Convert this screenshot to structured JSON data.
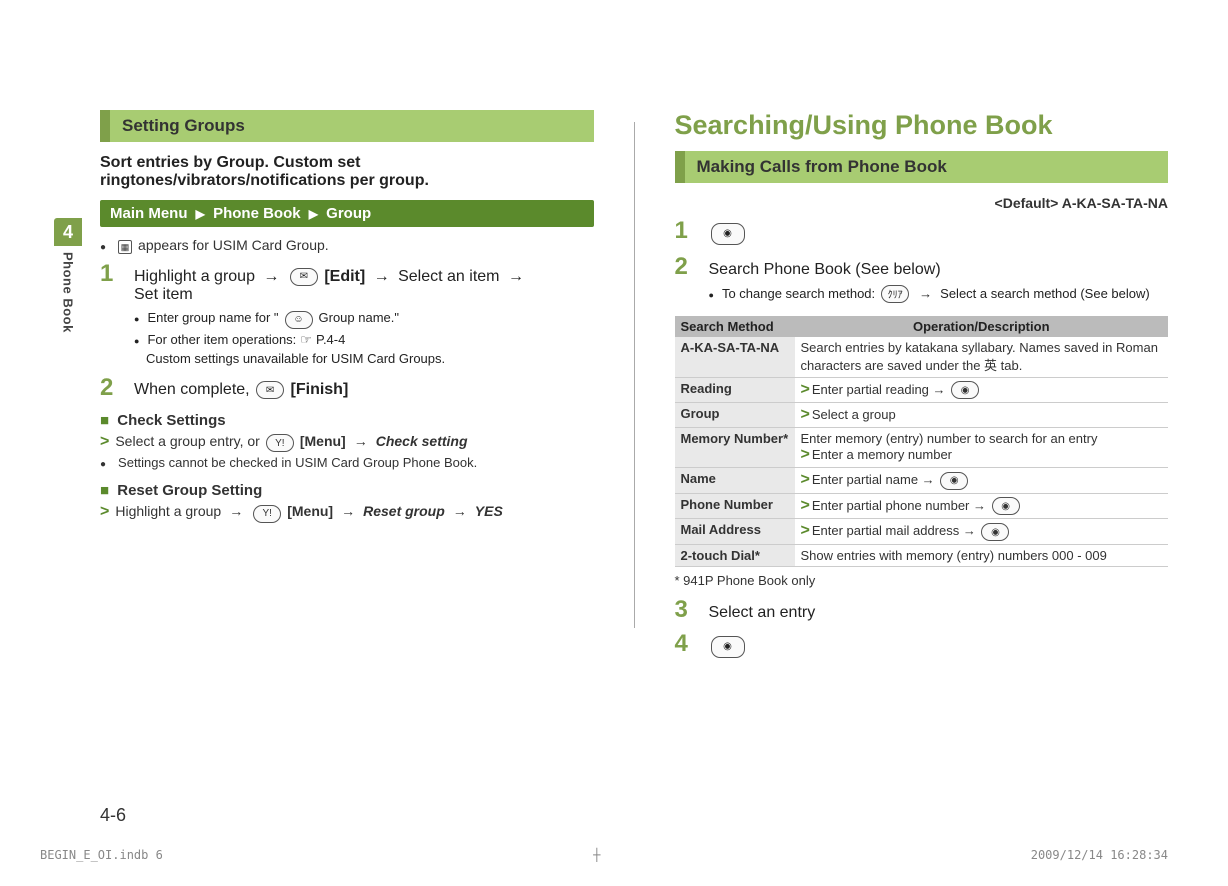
{
  "side_tab": {
    "chapter_num": "4",
    "chapter_title": "Phone Book"
  },
  "left": {
    "heading": "Setting Groups",
    "intro": "Sort entries by Group. Custom set ringtones/vibrators/notifications per group.",
    "nav": {
      "main": "Main Menu",
      "l1": "Phone Book",
      "l2": "Group"
    },
    "usim_note": " appears for USIM Card Group.",
    "step1": {
      "text_a": "Highlight a group ",
      "btn_label": "[Edit]",
      "text_b": " Select an item ",
      "text_c": "Set item",
      "sub1_a": "Enter group name for \"",
      "sub1_b": " Group name.\"",
      "sub2_a": "For other item operations: ",
      "sub2_b": "P.4-4",
      "sub3": "Custom settings unavailable for USIM Card Groups."
    },
    "step2": {
      "text": "When complete, ",
      "btn_label": "[Finish]"
    },
    "check": {
      "title": "Check Settings",
      "line_a": "Select a group entry, or ",
      "btn_label": "[Menu]",
      "action": "Check setting",
      "note": "Settings cannot be checked in USIM Card Group Phone Book."
    },
    "reset": {
      "title": "Reset Group Setting",
      "line_a": "Highlight a group ",
      "btn_label": "[Menu]",
      "action": "Reset group",
      "yes": "YES"
    }
  },
  "right": {
    "title": "Searching/Using Phone Book",
    "heading": "Making Calls from Phone Book",
    "default": "<Default> A-KA-SA-TA-NA",
    "step2_text": "Search Phone Book (See below)",
    "step2_sub": "To change search method: ",
    "step2_sub_b": " Select a search method (See below)",
    "table": {
      "h1": "Search Method",
      "h2": "Operation/Description",
      "rows": [
        {
          "label": "A-KA-SA-TA-NA",
          "desc": "Search entries by katakana syllabary. Names saved in Roman characters are saved under the 英 tab."
        },
        {
          "label": "Reading",
          "desc": "Enter partial reading → "
        },
        {
          "label": "Group",
          "desc": "Select a group"
        },
        {
          "label": "Memory Number*",
          "desc_a": "Enter memory (entry) number to search for an entry",
          "desc_b": "Enter a memory number"
        },
        {
          "label": "Name",
          "desc": "Enter partial name → "
        },
        {
          "label": "Phone Number",
          "desc": "Enter partial phone number → "
        },
        {
          "label": "Mail Address",
          "desc": "Enter partial mail address → "
        },
        {
          "label": "2-touch Dial*",
          "desc": "Show entries with memory (entry) numbers 000 - 009"
        }
      ]
    },
    "footnote": "* 941P Phone Book only",
    "step3": "Select an entry"
  },
  "page_num": "4-6",
  "footer": {
    "left": "BEGIN_E_OI.indb   6",
    "right": "2009/12/14   16:28:34"
  }
}
